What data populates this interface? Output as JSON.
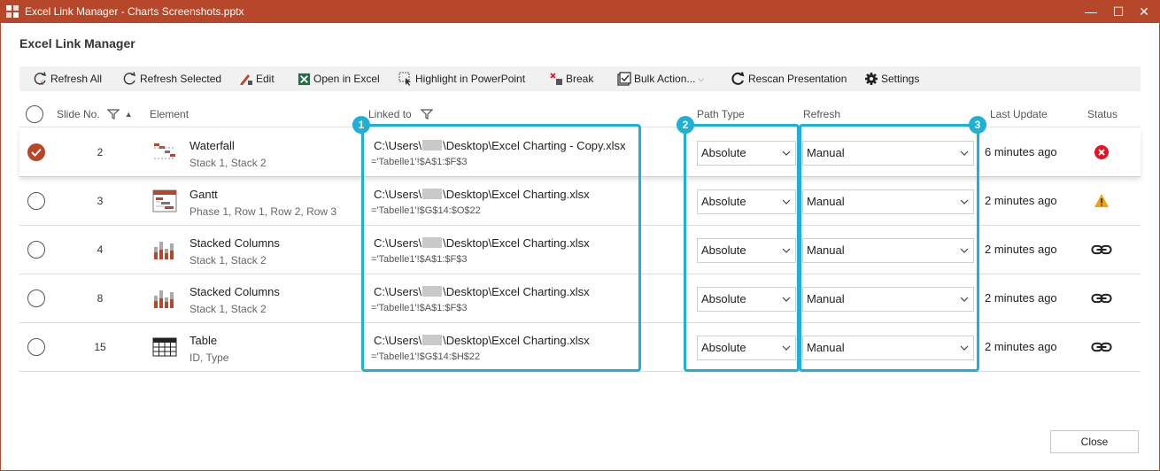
{
  "window": {
    "title": "Excel Link Manager - Charts Screenshots.pptx",
    "minimize": "—",
    "maximize": "☐",
    "close": "✕"
  },
  "heading": "Excel Link Manager",
  "toolbar": {
    "refresh_all": "Refresh All",
    "refresh_selected": "Refresh Selected",
    "edit": "Edit",
    "open_in_excel": "Open in Excel",
    "highlight": "Highlight in PowerPoint",
    "break": "Break",
    "bulk_action": "Bulk Action...",
    "rescan": "Rescan Presentation",
    "settings": "Settings"
  },
  "columns": {
    "slide_no": "Slide No.",
    "element": "Element",
    "linked_to": "Linked to",
    "path_type": "Path Type",
    "refresh": "Refresh",
    "last_update": "Last Update",
    "status": "Status"
  },
  "rows": [
    {
      "selected": true,
      "slide": "2",
      "icon": "waterfall-chart-icon",
      "name": "Waterfall",
      "sub": "Stack 1, Stack 2",
      "path_pre": "C:\\Users\\",
      "path_post": "\\Desktop\\Excel Charting - Copy.xlsx",
      "ref": "='Tabelle1'!$A$1:$F$3",
      "path_type": "Absolute",
      "refresh": "Manual",
      "last_update": "6 minutes ago",
      "status": "error"
    },
    {
      "selected": false,
      "slide": "3",
      "icon": "gantt-chart-icon",
      "name": "Gantt",
      "sub": "Phase 1, Row 1, Row 2, Row 3",
      "path_pre": "C:\\Users\\",
      "path_post": "\\Desktop\\Excel Charting.xlsx",
      "ref": "='Tabelle1'!$G$14:$O$22",
      "path_type": "Absolute",
      "refresh": "Manual",
      "last_update": "2 minutes ago",
      "status": "warning"
    },
    {
      "selected": false,
      "slide": "4",
      "icon": "stacked-columns-icon",
      "name": "Stacked Columns",
      "sub": "Stack 1, Stack 2",
      "path_pre": "C:\\Users\\",
      "path_post": "\\Desktop\\Excel Charting.xlsx",
      "ref": "='Tabelle1'!$A$1:$F$3",
      "path_type": "Absolute",
      "refresh": "Manual",
      "last_update": "2 minutes ago",
      "status": "linked"
    },
    {
      "selected": false,
      "slide": "8",
      "icon": "stacked-columns-icon",
      "name": "Stacked Columns",
      "sub": "Stack 1, Stack 2",
      "path_pre": "C:\\Users\\",
      "path_post": "\\Desktop\\Excel Charting.xlsx",
      "ref": "='Tabelle1'!$A$1:$F$3",
      "path_type": "Absolute",
      "refresh": "Manual",
      "last_update": "2 minutes ago",
      "status": "linked"
    },
    {
      "selected": false,
      "slide": "15",
      "icon": "table-icon",
      "name": "Table",
      "sub": "ID, Type",
      "path_pre": "C:\\Users\\",
      "path_post": "\\Desktop\\Excel Charting.xlsx",
      "ref": "='Tabelle1'!$G$14:$H$22",
      "path_type": "Absolute",
      "refresh": "Manual",
      "last_update": "2 minutes ago",
      "status": "linked"
    }
  ],
  "callouts": [
    "1",
    "2",
    "3"
  ],
  "close_button": "Close",
  "colors": {
    "accent": "#b7472a",
    "callout": "#1fb0d8",
    "error": "#e81123",
    "warning": "#f0a30a"
  }
}
